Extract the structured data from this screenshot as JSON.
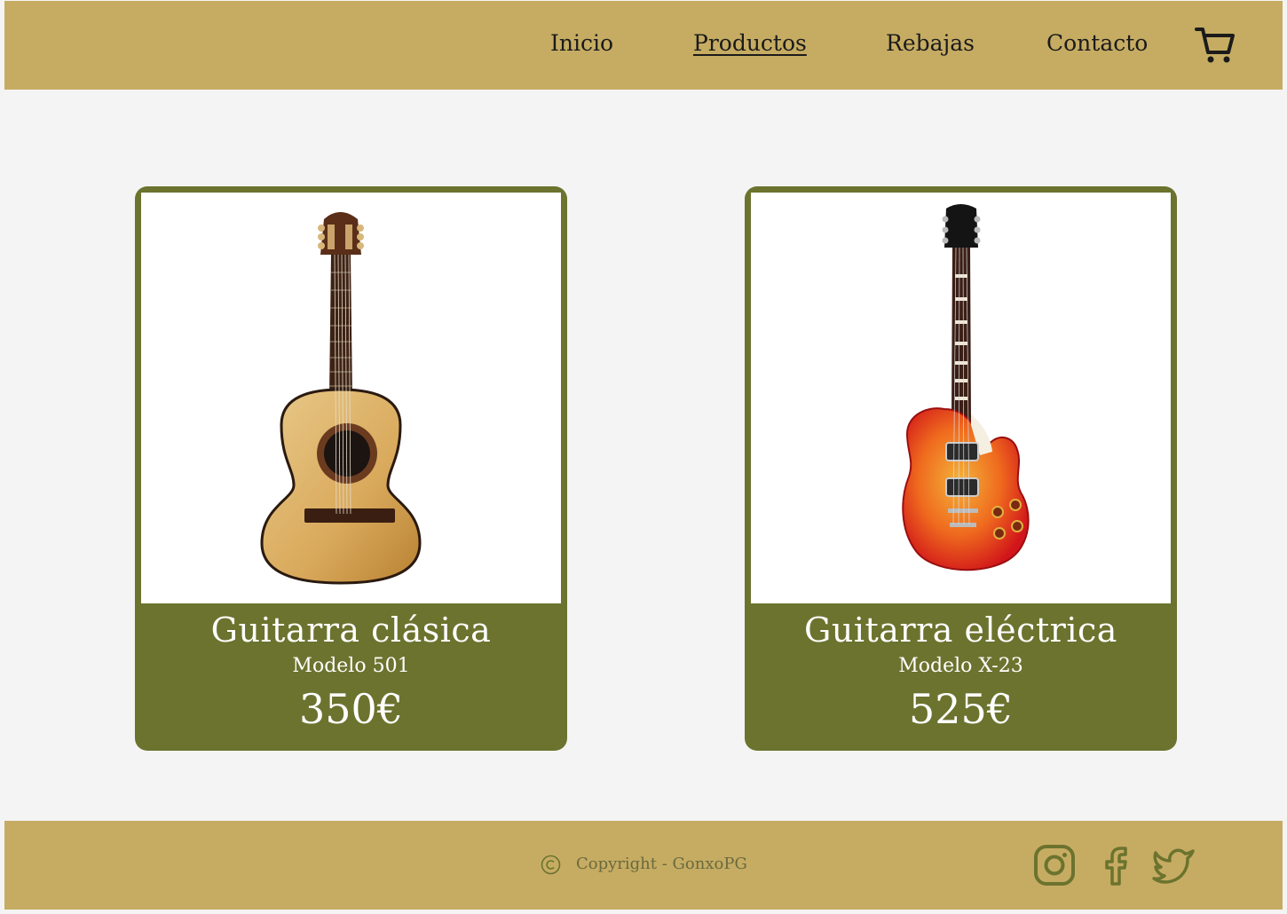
{
  "nav": {
    "items": [
      {
        "label": "Inicio"
      },
      {
        "label": "Productos",
        "active": true
      },
      {
        "label": "Rebajas"
      },
      {
        "label": "Contacto"
      }
    ],
    "cart_icon": "cart-icon"
  },
  "products": [
    {
      "name": "Guitarra clásica",
      "model": "Modelo 501",
      "price": "350€",
      "image": "classical-guitar"
    },
    {
      "name": "Guitarra eléctrica",
      "model": "Modelo X-23",
      "price": "525€",
      "image": "electric-guitar"
    }
  ],
  "footer": {
    "copyright": "Copyright - GonxoPG",
    "social": [
      "instagram-icon",
      "facebook-icon",
      "twitter-icon"
    ]
  },
  "colors": {
    "header_bg": "#c6ac62",
    "card_bg": "#6b732e",
    "page_bg": "#f4f4f4",
    "icon": "#6b732e"
  }
}
